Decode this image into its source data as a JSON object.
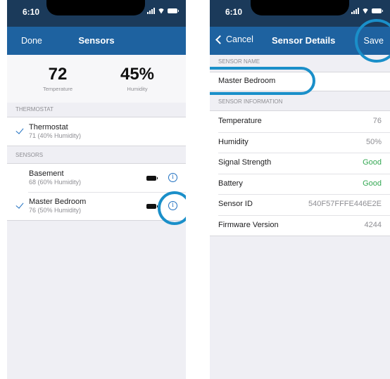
{
  "left": {
    "status_time": "6:10",
    "nav": {
      "done_label": "Done",
      "title": "Sensors"
    },
    "summary": {
      "temperature_value": "72",
      "temperature_label": "Temperature",
      "humidity_value": "45%",
      "humidity_label": "Humidity"
    },
    "thermostat_header": "THERMOSTAT",
    "thermostat": {
      "name": "Thermostat",
      "detail": "71 (40% Humidity)",
      "selected": true
    },
    "sensors_header": "SENSORS",
    "sensors": [
      {
        "name": "Basement",
        "detail": "68 (60% Humidity)",
        "selected": false
      },
      {
        "name": "Master Bedroom",
        "detail": "76 (50% Humidity)",
        "selected": true
      }
    ]
  },
  "right": {
    "status_time": "6:10",
    "nav": {
      "back_label": "Cancel",
      "title": "Sensor Details",
      "save_label": "Save"
    },
    "sensor_name_header": "SENSOR NAME",
    "sensor_name_value": "Master Bedroom",
    "sensor_info_header": "SENSOR INFORMATION",
    "info_rows": [
      {
        "label": "Temperature",
        "value": "76"
      },
      {
        "label": "Humidity",
        "value": "50%"
      },
      {
        "label": "Signal Strength",
        "value": "Good"
      },
      {
        "label": "Battery",
        "value": "Good"
      },
      {
        "label": "Sensor ID",
        "value": "540F57FFFE446E2E"
      },
      {
        "label": "Firmware Version",
        "value": "4244"
      }
    ]
  },
  "colors": {
    "nav_bar": "#1e62a0",
    "status_bar": "#1b3a5a",
    "accent": "#1e6fc0",
    "good": "#34a853",
    "highlight": "#1a8fc9"
  }
}
